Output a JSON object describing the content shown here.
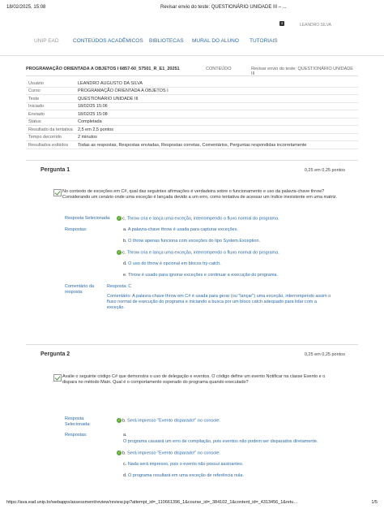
{
  "print": {
    "date": "18/02/2025, 15:08",
    "title": "Revisar envio do teste: QUESTIONÁRIO UNIDADE III – ...",
    "url": "https://ava.ead.unip.br/webapps/assessment/review/review.jsp?attempt_id=_110661396_1&course_id=_384102_1&content_id=_4313456_1&retu…",
    "page": "1/5"
  },
  "topbar": {
    "badge": "3",
    "user": "LEANDRO SILVA"
  },
  "nav": {
    "unip": "UNIP EAD",
    "items": [
      "CONTEÚDOS ACADÊMICOS",
      "BIBLIOTECAS",
      "MURAL DO ALUNO",
      "TUTORIAIS"
    ]
  },
  "breadcrumb": {
    "course": "PROGRAMAÇÃO ORIENTADA A OBJETOS I 6857-60_57501_R_E1_20251",
    "content": "CONTEÚDO",
    "page": "Revisar envio do teste: QUESTIONÁRIO UNIDADE III"
  },
  "info": [
    {
      "k": "Usuário",
      "v": "LEANDRO AUGUSTO DA SILVA"
    },
    {
      "k": "Curso",
      "v": "PROGRAMAÇÃO ORIENTADA A OBJETOS I"
    },
    {
      "k": "Teste",
      "v": "QUESTIONÁRIO UNIDADE III"
    },
    {
      "k": "Iniciado",
      "v": "18/02/25 15:06"
    },
    {
      "k": "Enviado",
      "v": "18/02/25 15:08"
    },
    {
      "k": "Status",
      "v": "Completada"
    },
    {
      "k": "Resultado da tentativa",
      "v": "2,5 em 2,5 pontos"
    },
    {
      "k": "Tempo decorrido",
      "v": "2 minutos"
    },
    {
      "k": "Resultados exibidos",
      "v": "Todas as respostas, Respostas enviadas, Respostas corretas, Comentários, Perguntas respondidas incorretamente"
    }
  ],
  "q1": {
    "title": "Pergunta 1",
    "points": "0,25 em 0,25 pontos",
    "text": "No contexto de exceções em C#, qual das seguintes afirmações é verdadeira sobre o funcionamento e uso da palavra-chave throw? Considerando um cenário onde uma exceção é lançada devido a um erro, como tentativa de acessar um índice inexistente em uma matriz.",
    "selected_label": "Resposta Selecionada:",
    "selected_letter": "c.",
    "selected": "Throw cria e lança uma exceção, interrompendo o fluxo normal do programa.",
    "answers_label": "Respostas:",
    "answers": [
      {
        "l": "a.",
        "t": "A palavra-chave throw é usada para capturar exceções."
      },
      {
        "l": "b.",
        "t": "O throw apenas funciona com exceções do tipo System.Exception."
      },
      {
        "l": "c.",
        "t": "Throw cria e lança uma exceção, interrompendo o fluxo normal do programa."
      },
      {
        "l": "d.",
        "t": "O uso do throw é opcional em blocos try-catch."
      },
      {
        "l": "e.",
        "t": "Throw é usado para ignorar exceções e continuar a execução do programa."
      }
    ],
    "comment_label": "Comentário da resposta:",
    "comment_answer": "Resposta: C",
    "comment": "Comentário: A palavra-chave throw em C# é usada para gerar (ou \"lançar\") uma exceção, interrompendo assim o fluxo normal de execução do programa e iniciando a busca por um bloco catch adequado para lidar com a exceção."
  },
  "q2": {
    "title": "Pergunta 2",
    "points": "0,25 em 0,25 pontos",
    "text": "Avalie o seguinte código C# que demonstra o uso de delegação e eventos. O código define um evento Notificar na classe Evento e o dispara no método Main. Qual é o comportamento esperado do programa quando executado?",
    "selected_label": "Resposta Selecionada:",
    "selected_letter": "b.",
    "selected": "Será impresso \"Evento disparado!\" no console.",
    "answers_label": "Respostas:",
    "answers": [
      {
        "l": "a.",
        "t": ""
      },
      {
        "l": "",
        "t": "O programa causará um erro de compilação, pois eventos não podem ser disparados diretamente."
      },
      {
        "l": "b.",
        "t": "Será impresso \"Evento disparado!\" no console."
      },
      {
        "l": "c.",
        "t": "Nada será impresso, pois o evento não possui assinantes."
      },
      {
        "l": "d.",
        "t": "O programa resultará em uma exceção de referência nula."
      }
    ]
  },
  "colors": {
    "link": "#2d6aa8",
    "check": "#5aa832"
  }
}
